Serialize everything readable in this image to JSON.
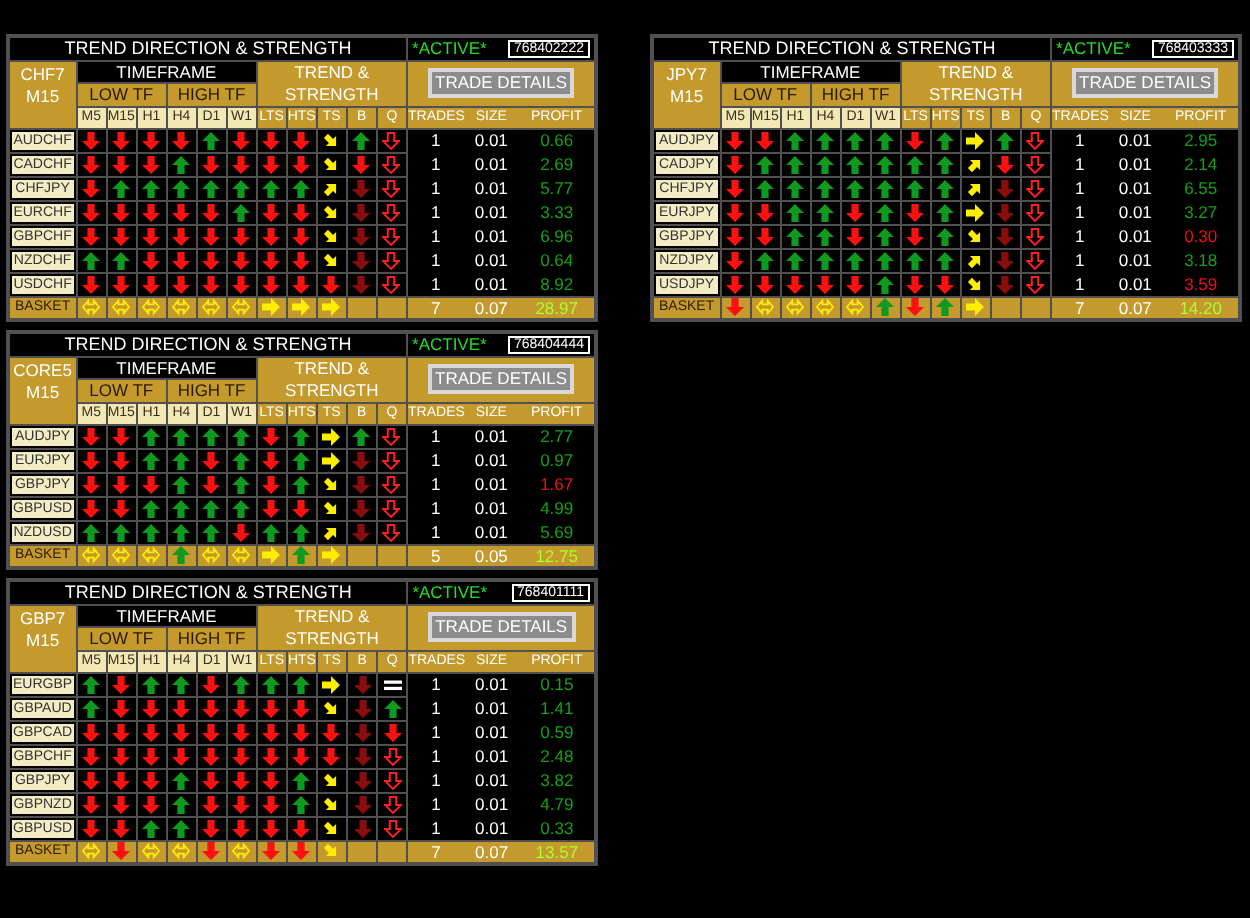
{
  "panels": [
    {
      "title": "TREND DIRECTION & STRENGTH",
      "status": "*ACTIVE*",
      "account": "768402222",
      "group": "CHF7",
      "period": "M15",
      "timeframe": "TIMEFRAME",
      "low_tf": "LOW TF",
      "high_tf": "HIGH TF",
      "trend_strength": "TREND & STRENGTH",
      "button": "TRADE DETAILS",
      "columns": [
        "M5",
        "M15",
        "H1",
        "H4",
        "D1",
        "W1",
        "LTS",
        "HTS",
        "TS",
        "B",
        "Q"
      ],
      "trade_columns": [
        "TRADES",
        "SIZE",
        "PROFIT"
      ],
      "rows": [
        {
          "kind": "pair",
          "pair": "AUDCHF",
          "signals": [
            {
              "kind": "down"
            },
            {
              "kind": "down"
            },
            {
              "kind": "down"
            },
            {
              "kind": "down"
            },
            {
              "kind": "up"
            },
            {
              "kind": "down"
            },
            {
              "kind": "down"
            },
            {
              "kind": "down"
            },
            {
              "kind": "down-right"
            },
            {
              "kind": "up"
            },
            {
              "kind": "hollow-down"
            }
          ],
          "trades": "1",
          "size": "0.01",
          "profit": "0.66",
          "loss": false
        },
        {
          "kind": "pair",
          "pair": "CADCHF",
          "signals": [
            {
              "kind": "down"
            },
            {
              "kind": "down"
            },
            {
              "kind": "down"
            },
            {
              "kind": "up"
            },
            {
              "kind": "down"
            },
            {
              "kind": "down"
            },
            {
              "kind": "down"
            },
            {
              "kind": "down"
            },
            {
              "kind": "down-right"
            },
            {
              "kind": "down"
            },
            {
              "kind": "hollow-down"
            }
          ],
          "trades": "1",
          "size": "0.01",
          "profit": "2.69",
          "loss": false
        },
        {
          "kind": "pair",
          "pair": "CHFJPY",
          "signals": [
            {
              "kind": "down"
            },
            {
              "kind": "up"
            },
            {
              "kind": "up"
            },
            {
              "kind": "up"
            },
            {
              "kind": "up"
            },
            {
              "kind": "up"
            },
            {
              "kind": "up"
            },
            {
              "kind": "up"
            },
            {
              "kind": "up-right"
            },
            {
              "kind": "dim-down"
            },
            {
              "kind": "hollow-down"
            }
          ],
          "trades": "1",
          "size": "0.01",
          "profit": "5.77",
          "loss": false
        },
        {
          "kind": "pair",
          "pair": "EURCHF",
          "signals": [
            {
              "kind": "down"
            },
            {
              "kind": "down"
            },
            {
              "kind": "down"
            },
            {
              "kind": "down"
            },
            {
              "kind": "down"
            },
            {
              "kind": "up"
            },
            {
              "kind": "down"
            },
            {
              "kind": "down"
            },
            {
              "kind": "down-right"
            },
            {
              "kind": "dim-down"
            },
            {
              "kind": "hollow-down"
            }
          ],
          "trades": "1",
          "size": "0.01",
          "profit": "3.33",
          "loss": false
        },
        {
          "kind": "pair",
          "pair": "GBPCHF",
          "signals": [
            {
              "kind": "down"
            },
            {
              "kind": "down"
            },
            {
              "kind": "down"
            },
            {
              "kind": "down"
            },
            {
              "kind": "down"
            },
            {
              "kind": "down"
            },
            {
              "kind": "down"
            },
            {
              "kind": "down"
            },
            {
              "kind": "down-right"
            },
            {
              "kind": "dim-down"
            },
            {
              "kind": "hollow-down"
            }
          ],
          "trades": "1",
          "size": "0.01",
          "profit": "6.96",
          "loss": false
        },
        {
          "kind": "pair",
          "pair": "NZDCHF",
          "signals": [
            {
              "kind": "up"
            },
            {
              "kind": "up"
            },
            {
              "kind": "down"
            },
            {
              "kind": "down"
            },
            {
              "kind": "down"
            },
            {
              "kind": "down"
            },
            {
              "kind": "down"
            },
            {
              "kind": "down"
            },
            {
              "kind": "down-right"
            },
            {
              "kind": "dim-down"
            },
            {
              "kind": "hollow-down"
            }
          ],
          "trades": "1",
          "size": "0.01",
          "profit": "0.64",
          "loss": false
        },
        {
          "kind": "pair",
          "pair": "USDCHF",
          "signals": [
            {
              "kind": "down"
            },
            {
              "kind": "down"
            },
            {
              "kind": "down"
            },
            {
              "kind": "down"
            },
            {
              "kind": "down"
            },
            {
              "kind": "down"
            },
            {
              "kind": "down"
            },
            {
              "kind": "down"
            },
            {
              "kind": "down"
            },
            {
              "kind": "dim-down"
            },
            {
              "kind": "hollow-down"
            }
          ],
          "trades": "1",
          "size": "0.01",
          "profit": "8.92",
          "loss": false
        },
        {
          "kind": "basket",
          "pair": "BASKET",
          "signals": [
            {
              "kind": "both-ways"
            },
            {
              "kind": "both-ways"
            },
            {
              "kind": "both-ways"
            },
            {
              "kind": "both-ways"
            },
            {
              "kind": "both-ways"
            },
            {
              "kind": "both-ways"
            },
            {
              "kind": "right"
            },
            {
              "kind": "right"
            },
            {
              "kind": "right"
            },
            {
              "kind": "blank"
            },
            {
              "kind": "blank"
            }
          ],
          "trades": "7",
          "size": "0.07",
          "profit": "28.97",
          "loss": false
        }
      ]
    },
    {
      "title": "TREND DIRECTION & STRENGTH",
      "status": "*ACTIVE*",
      "account": "768403333",
      "group": "JPY7",
      "period": "M15",
      "timeframe": "TIMEFRAME",
      "low_tf": "LOW TF",
      "high_tf": "HIGH TF",
      "trend_strength": "TREND & STRENGTH",
      "button": "TRADE DETAILS",
      "columns": [
        "M5",
        "M15",
        "H1",
        "H4",
        "D1",
        "W1",
        "LTS",
        "HTS",
        "TS",
        "B",
        "Q"
      ],
      "trade_columns": [
        "TRADES",
        "SIZE",
        "PROFIT"
      ],
      "rows": [
        {
          "kind": "pair",
          "pair": "AUDJPY",
          "signals": [
            {
              "kind": "down"
            },
            {
              "kind": "down"
            },
            {
              "kind": "up"
            },
            {
              "kind": "up"
            },
            {
              "kind": "up"
            },
            {
              "kind": "up"
            },
            {
              "kind": "down"
            },
            {
              "kind": "up"
            },
            {
              "kind": "right"
            },
            {
              "kind": "up"
            },
            {
              "kind": "hollow-down"
            }
          ],
          "trades": "1",
          "size": "0.01",
          "profit": "2.95",
          "loss": false
        },
        {
          "kind": "pair",
          "pair": "CADJPY",
          "signals": [
            {
              "kind": "down"
            },
            {
              "kind": "up"
            },
            {
              "kind": "up"
            },
            {
              "kind": "up"
            },
            {
              "kind": "up"
            },
            {
              "kind": "up"
            },
            {
              "kind": "up"
            },
            {
              "kind": "up"
            },
            {
              "kind": "up-right"
            },
            {
              "kind": "down"
            },
            {
              "kind": "hollow-down"
            }
          ],
          "trades": "1",
          "size": "0.01",
          "profit": "2.14",
          "loss": false
        },
        {
          "kind": "pair",
          "pair": "CHFJPY",
          "signals": [
            {
              "kind": "down"
            },
            {
              "kind": "up"
            },
            {
              "kind": "up"
            },
            {
              "kind": "up"
            },
            {
              "kind": "up"
            },
            {
              "kind": "up"
            },
            {
              "kind": "up"
            },
            {
              "kind": "up"
            },
            {
              "kind": "up-right"
            },
            {
              "kind": "dim-down"
            },
            {
              "kind": "hollow-down"
            }
          ],
          "trades": "1",
          "size": "0.01",
          "profit": "6.55",
          "loss": false
        },
        {
          "kind": "pair",
          "pair": "EURJPY",
          "signals": [
            {
              "kind": "down"
            },
            {
              "kind": "down"
            },
            {
              "kind": "up"
            },
            {
              "kind": "up"
            },
            {
              "kind": "down"
            },
            {
              "kind": "up"
            },
            {
              "kind": "down"
            },
            {
              "kind": "up"
            },
            {
              "kind": "right"
            },
            {
              "kind": "dim-down"
            },
            {
              "kind": "hollow-down"
            }
          ],
          "trades": "1",
          "size": "0.01",
          "profit": "3.27",
          "loss": false
        },
        {
          "kind": "pair",
          "pair": "GBPJPY",
          "signals": [
            {
              "kind": "down"
            },
            {
              "kind": "down"
            },
            {
              "kind": "up"
            },
            {
              "kind": "up"
            },
            {
              "kind": "down"
            },
            {
              "kind": "up"
            },
            {
              "kind": "down"
            },
            {
              "kind": "up"
            },
            {
              "kind": "down-right"
            },
            {
              "kind": "dim-down"
            },
            {
              "kind": "hollow-down"
            }
          ],
          "trades": "1",
          "size": "0.01",
          "profit": "0.30",
          "loss": true
        },
        {
          "kind": "pair",
          "pair": "NZDJPY",
          "signals": [
            {
              "kind": "down"
            },
            {
              "kind": "up"
            },
            {
              "kind": "up"
            },
            {
              "kind": "up"
            },
            {
              "kind": "up"
            },
            {
              "kind": "up"
            },
            {
              "kind": "up"
            },
            {
              "kind": "up"
            },
            {
              "kind": "up-right"
            },
            {
              "kind": "dim-down"
            },
            {
              "kind": "hollow-down"
            }
          ],
          "trades": "1",
          "size": "0.01",
          "profit": "3.18",
          "loss": false
        },
        {
          "kind": "pair",
          "pair": "USDJPY",
          "signals": [
            {
              "kind": "down"
            },
            {
              "kind": "down"
            },
            {
              "kind": "down"
            },
            {
              "kind": "down"
            },
            {
              "kind": "down"
            },
            {
              "kind": "up"
            },
            {
              "kind": "down"
            },
            {
              "kind": "down"
            },
            {
              "kind": "down-right"
            },
            {
              "kind": "dim-down"
            },
            {
              "kind": "hollow-down"
            }
          ],
          "trades": "1",
          "size": "0.01",
          "profit": "3.59",
          "loss": true
        },
        {
          "kind": "basket",
          "pair": "BASKET",
          "signals": [
            {
              "kind": "down"
            },
            {
              "kind": "both-ways"
            },
            {
              "kind": "both-ways"
            },
            {
              "kind": "both-ways"
            },
            {
              "kind": "both-ways"
            },
            {
              "kind": "up"
            },
            {
              "kind": "down"
            },
            {
              "kind": "up"
            },
            {
              "kind": "right"
            },
            {
              "kind": "blank"
            },
            {
              "kind": "blank"
            }
          ],
          "trades": "7",
          "size": "0.07",
          "profit": "14.20",
          "loss": false
        }
      ]
    },
    {
      "title": "TREND DIRECTION & STRENGTH",
      "status": "*ACTIVE*",
      "account": "768404444",
      "group": "CORE5",
      "period": "M15",
      "timeframe": "TIMEFRAME",
      "low_tf": "LOW TF",
      "high_tf": "HIGH TF",
      "trend_strength": "TREND & STRENGTH",
      "button": "TRADE DETAILS",
      "columns": [
        "M5",
        "M15",
        "H1",
        "H4",
        "D1",
        "W1",
        "LTS",
        "HTS",
        "TS",
        "B",
        "Q"
      ],
      "trade_columns": [
        "TRADES",
        "SIZE",
        "PROFIT"
      ],
      "rows": [
        {
          "kind": "pair",
          "pair": "AUDJPY",
          "signals": [
            {
              "kind": "down"
            },
            {
              "kind": "down"
            },
            {
              "kind": "up"
            },
            {
              "kind": "up"
            },
            {
              "kind": "up"
            },
            {
              "kind": "up"
            },
            {
              "kind": "down"
            },
            {
              "kind": "up"
            },
            {
              "kind": "right"
            },
            {
              "kind": "up"
            },
            {
              "kind": "hollow-down"
            }
          ],
          "trades": "1",
          "size": "0.01",
          "profit": "2.77",
          "loss": false
        },
        {
          "kind": "pair",
          "pair": "EURJPY",
          "signals": [
            {
              "kind": "down"
            },
            {
              "kind": "down"
            },
            {
              "kind": "up"
            },
            {
              "kind": "up"
            },
            {
              "kind": "down"
            },
            {
              "kind": "up"
            },
            {
              "kind": "down"
            },
            {
              "kind": "up"
            },
            {
              "kind": "right"
            },
            {
              "kind": "dim-down"
            },
            {
              "kind": "hollow-down"
            }
          ],
          "trades": "1",
          "size": "0.01",
          "profit": "0.97",
          "loss": false
        },
        {
          "kind": "pair",
          "pair": "GBPJPY",
          "signals": [
            {
              "kind": "down"
            },
            {
              "kind": "down"
            },
            {
              "kind": "down"
            },
            {
              "kind": "up"
            },
            {
              "kind": "down"
            },
            {
              "kind": "up"
            },
            {
              "kind": "down"
            },
            {
              "kind": "up"
            },
            {
              "kind": "down-right"
            },
            {
              "kind": "dim-down"
            },
            {
              "kind": "hollow-down"
            }
          ],
          "trades": "1",
          "size": "0.01",
          "profit": "1.67",
          "loss": true
        },
        {
          "kind": "pair",
          "pair": "GBPUSD",
          "signals": [
            {
              "kind": "down"
            },
            {
              "kind": "down"
            },
            {
              "kind": "up"
            },
            {
              "kind": "up"
            },
            {
              "kind": "up"
            },
            {
              "kind": "up"
            },
            {
              "kind": "down"
            },
            {
              "kind": "down"
            },
            {
              "kind": "down-right"
            },
            {
              "kind": "dim-down"
            },
            {
              "kind": "hollow-down"
            }
          ],
          "trades": "1",
          "size": "0.01",
          "profit": "4.99",
          "loss": false
        },
        {
          "kind": "pair",
          "pair": "NZDUSD",
          "signals": [
            {
              "kind": "up"
            },
            {
              "kind": "up"
            },
            {
              "kind": "up"
            },
            {
              "kind": "up"
            },
            {
              "kind": "up"
            },
            {
              "kind": "down"
            },
            {
              "kind": "up"
            },
            {
              "kind": "up"
            },
            {
              "kind": "up-right"
            },
            {
              "kind": "dim-down"
            },
            {
              "kind": "hollow-down"
            }
          ],
          "trades": "1",
          "size": "0.01",
          "profit": "5.69",
          "loss": false
        },
        {
          "kind": "basket",
          "pair": "BASKET",
          "signals": [
            {
              "kind": "both-ways"
            },
            {
              "kind": "both-ways"
            },
            {
              "kind": "both-ways"
            },
            {
              "kind": "up"
            },
            {
              "kind": "both-ways"
            },
            {
              "kind": "both-ways"
            },
            {
              "kind": "right"
            },
            {
              "kind": "up"
            },
            {
              "kind": "right"
            },
            {
              "kind": "blank"
            },
            {
              "kind": "blank"
            }
          ],
          "trades": "5",
          "size": "0.05",
          "profit": "12.75",
          "loss": false
        }
      ]
    },
    {
      "title": "TREND DIRECTION & STRENGTH",
      "status": "*ACTIVE*",
      "account": "768401111",
      "group": "GBP7",
      "period": "M15",
      "timeframe": "TIMEFRAME",
      "low_tf": "LOW TF",
      "high_tf": "HIGH TF",
      "trend_strength": "TREND & STRENGTH",
      "button": "TRADE DETAILS",
      "columns": [
        "M5",
        "M15",
        "H1",
        "H4",
        "D1",
        "W1",
        "LTS",
        "HTS",
        "TS",
        "B",
        "Q"
      ],
      "trade_columns": [
        "TRADES",
        "SIZE",
        "PROFIT"
      ],
      "rows": [
        {
          "kind": "pair",
          "pair": "EURGBP",
          "signals": [
            {
              "kind": "up"
            },
            {
              "kind": "down"
            },
            {
              "kind": "up"
            },
            {
              "kind": "up"
            },
            {
              "kind": "down"
            },
            {
              "kind": "up"
            },
            {
              "kind": "up"
            },
            {
              "kind": "up"
            },
            {
              "kind": "right"
            },
            {
              "kind": "dim-down"
            },
            {
              "kind": "equal"
            }
          ],
          "trades": "1",
          "size": "0.01",
          "profit": "0.15",
          "loss": false
        },
        {
          "kind": "pair",
          "pair": "GBPAUD",
          "signals": [
            {
              "kind": "up"
            },
            {
              "kind": "down"
            },
            {
              "kind": "down"
            },
            {
              "kind": "down"
            },
            {
              "kind": "down"
            },
            {
              "kind": "down"
            },
            {
              "kind": "down"
            },
            {
              "kind": "down"
            },
            {
              "kind": "down-right"
            },
            {
              "kind": "dim-down"
            },
            {
              "kind": "up"
            }
          ],
          "trades": "1",
          "size": "0.01",
          "profit": "1.41",
          "loss": false
        },
        {
          "kind": "pair",
          "pair": "GBPCAD",
          "signals": [
            {
              "kind": "down"
            },
            {
              "kind": "down"
            },
            {
              "kind": "down"
            },
            {
              "kind": "down"
            },
            {
              "kind": "down"
            },
            {
              "kind": "down"
            },
            {
              "kind": "down"
            },
            {
              "kind": "down"
            },
            {
              "kind": "down"
            },
            {
              "kind": "dim-down"
            },
            {
              "kind": "down"
            }
          ],
          "trades": "1",
          "size": "0.01",
          "profit": "0.59",
          "loss": false
        },
        {
          "kind": "pair",
          "pair": "GBPCHF",
          "signals": [
            {
              "kind": "down"
            },
            {
              "kind": "down"
            },
            {
              "kind": "down"
            },
            {
              "kind": "down"
            },
            {
              "kind": "down"
            },
            {
              "kind": "down"
            },
            {
              "kind": "down"
            },
            {
              "kind": "down"
            },
            {
              "kind": "down"
            },
            {
              "kind": "dim-down"
            },
            {
              "kind": "hollow-down"
            }
          ],
          "trades": "1",
          "size": "0.01",
          "profit": "2.48",
          "loss": false
        },
        {
          "kind": "pair",
          "pair": "GBPJPY",
          "signals": [
            {
              "kind": "down"
            },
            {
              "kind": "down"
            },
            {
              "kind": "down"
            },
            {
              "kind": "up"
            },
            {
              "kind": "down"
            },
            {
              "kind": "down"
            },
            {
              "kind": "down"
            },
            {
              "kind": "up"
            },
            {
              "kind": "down-right"
            },
            {
              "kind": "dim-down"
            },
            {
              "kind": "hollow-down"
            }
          ],
          "trades": "1",
          "size": "0.01",
          "profit": "3.82",
          "loss": false
        },
        {
          "kind": "pair",
          "pair": "GBPNZD",
          "signals": [
            {
              "kind": "down"
            },
            {
              "kind": "down"
            },
            {
              "kind": "down"
            },
            {
              "kind": "up"
            },
            {
              "kind": "down"
            },
            {
              "kind": "down"
            },
            {
              "kind": "down"
            },
            {
              "kind": "up"
            },
            {
              "kind": "down-right"
            },
            {
              "kind": "dim-down"
            },
            {
              "kind": "hollow-down"
            }
          ],
          "trades": "1",
          "size": "0.01",
          "profit": "4.79",
          "loss": false
        },
        {
          "kind": "pair",
          "pair": "GBPUSD",
          "signals": [
            {
              "kind": "down"
            },
            {
              "kind": "down"
            },
            {
              "kind": "up"
            },
            {
              "kind": "up"
            },
            {
              "kind": "down"
            },
            {
              "kind": "down"
            },
            {
              "kind": "down"
            },
            {
              "kind": "down"
            },
            {
              "kind": "down-right"
            },
            {
              "kind": "dim-down"
            },
            {
              "kind": "hollow-down"
            }
          ],
          "trades": "1",
          "size": "0.01",
          "profit": "0.33",
          "loss": false
        },
        {
          "kind": "basket",
          "pair": "BASKET",
          "signals": [
            {
              "kind": "both-ways"
            },
            {
              "kind": "down"
            },
            {
              "kind": "both-ways"
            },
            {
              "kind": "both-ways"
            },
            {
              "kind": "down"
            },
            {
              "kind": "both-ways"
            },
            {
              "kind": "down"
            },
            {
              "kind": "down"
            },
            {
              "kind": "down-right"
            },
            {
              "kind": "blank"
            },
            {
              "kind": "blank"
            }
          ],
          "trades": "7",
          "size": "0.07",
          "profit": "13.57",
          "loss": false
        }
      ]
    }
  ]
}
